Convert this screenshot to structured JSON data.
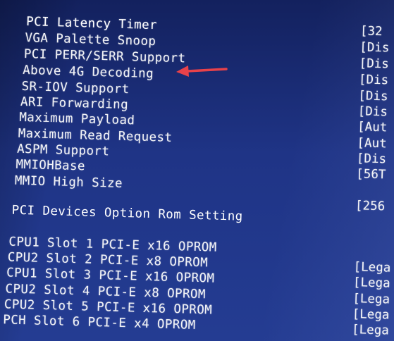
{
  "settings": [
    {
      "label": "PCI Latency Timer",
      "value": "[32"
    },
    {
      "label": "VGA Palette Snoop",
      "value": "[Dis"
    },
    {
      "label": "PCI PERR/SERR Support",
      "value": "[Dis"
    },
    {
      "label": "Above 4G Decoding",
      "value": "[Dis"
    },
    {
      "label": "SR-IOV Support",
      "value": "[Dis"
    },
    {
      "label": "ARI Forwarding",
      "value": "[Dis"
    },
    {
      "label": "Maximum Payload",
      "value": "[Aut"
    },
    {
      "label": "Maximum Read Request",
      "value": "[Aut"
    },
    {
      "label": "ASPM Support",
      "value": "[Dis"
    },
    {
      "label": "MMIOHBase",
      "value": "[56T"
    },
    {
      "label": "MMIO High Size",
      "value": "[256"
    }
  ],
  "section_heading": "PCI Devices Option Rom Setting",
  "slots": [
    {
      "label": "CPU1 Slot 1 PCI-E x16 OPROM",
      "value": ""
    },
    {
      "label": "CPU2 Slot 2 PCI-E x8 OPROM",
      "value": "[Lega"
    },
    {
      "label": "CPU1 Slot 3 PCI-E x16 OPROM",
      "value": "[Lega"
    },
    {
      "label": "CPU2 Slot 4 PCI-E x8 OPROM",
      "value": "[Lega"
    },
    {
      "label": "CPU2 Slot 5 PCI-E x16 OPROM",
      "value": "[Lega"
    },
    {
      "label": "PCH Slot 6 PCI-E x4 OPROM",
      "value": "[Lega"
    }
  ],
  "colors": {
    "background": "#1f3486",
    "text": "#f2f3f6",
    "arrow": "#e8424a"
  },
  "annotation": {
    "icon": "red-arrow-icon"
  }
}
